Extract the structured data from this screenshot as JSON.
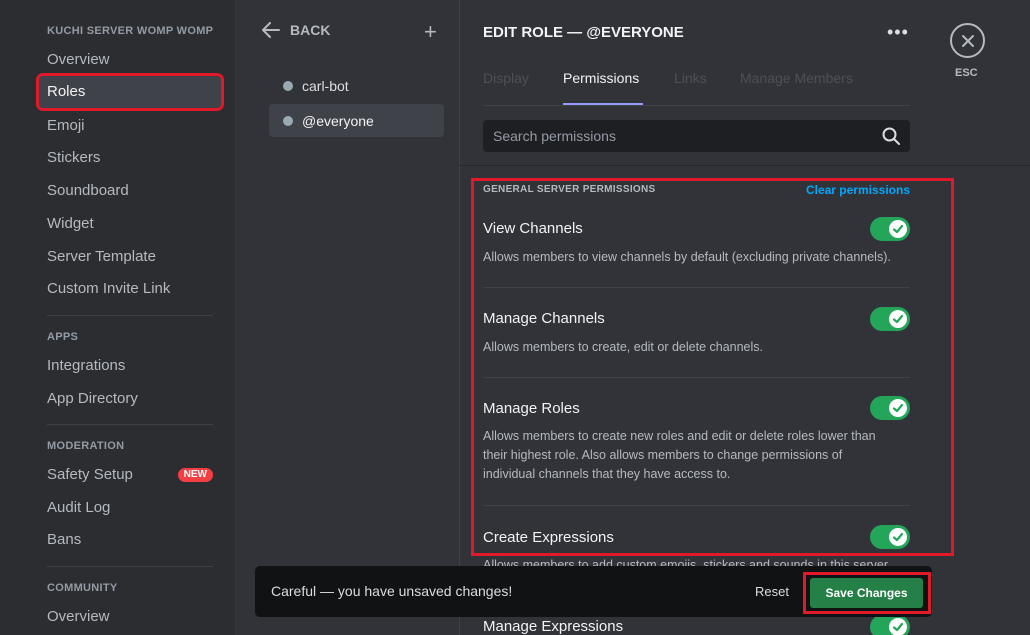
{
  "sidebar": {
    "server_header": "KUCHI SERVER WOMP WOMP",
    "items": [
      {
        "label": "Overview"
      },
      {
        "label": "Roles"
      },
      {
        "label": "Emoji"
      },
      {
        "label": "Stickers"
      },
      {
        "label": "Soundboard"
      },
      {
        "label": "Widget"
      },
      {
        "label": "Server Template"
      },
      {
        "label": "Custom Invite Link"
      }
    ],
    "apps_header": "APPS",
    "apps_items": [
      {
        "label": "Integrations"
      },
      {
        "label": "App Directory"
      }
    ],
    "moderation_header": "MODERATION",
    "moderation_items": [
      {
        "label": "Safety Setup",
        "badge": "NEW"
      },
      {
        "label": "Audit Log"
      },
      {
        "label": "Bans"
      }
    ],
    "community_header": "COMMUNITY",
    "community_items": [
      {
        "label": "Overview"
      }
    ]
  },
  "roles_list": {
    "back_label": "BACK",
    "add_symbol": "+",
    "roles": [
      {
        "name": "carl-bot"
      },
      {
        "name": "@everyone"
      }
    ]
  },
  "main": {
    "title": "EDIT ROLE — @EVERYONE",
    "more_symbol": "•••",
    "tabs": [
      {
        "label": "Display"
      },
      {
        "label": "Permissions"
      },
      {
        "label": "Links"
      },
      {
        "label": "Manage Members"
      }
    ],
    "search_placeholder": "Search permissions",
    "section_header": "GENERAL SERVER PERMISSIONS",
    "clear_label": "Clear permissions",
    "permissions": [
      {
        "name": "View Channels",
        "description": "Allows members to view channels by default (excluding private channels).",
        "enabled": true
      },
      {
        "name": "Manage Channels",
        "description": "Allows members to create, edit or delete channels.",
        "enabled": true
      },
      {
        "name": "Manage Roles",
        "description": "Allows members to create new roles and edit or delete roles lower than their highest role. Also allows members to change permissions of individual channels that they have access to.",
        "enabled": true
      },
      {
        "name": "Create Expressions",
        "description": "Allows members to add custom emojis, stickers and sounds in this server.",
        "enabled": true
      },
      {
        "name": "Manage Expressions",
        "enabled": true
      }
    ]
  },
  "close": {
    "label": "ESC"
  },
  "unsaved_bar": {
    "message": "Careful — you have unsaved changes!",
    "reset_label": "Reset",
    "save_label": "Save Changes"
  },
  "colors": {
    "accent_green": "#23a55a",
    "highlight_red": "#e2192a",
    "link_blue": "#00a8fc",
    "tab_underline": "#949cf7"
  }
}
